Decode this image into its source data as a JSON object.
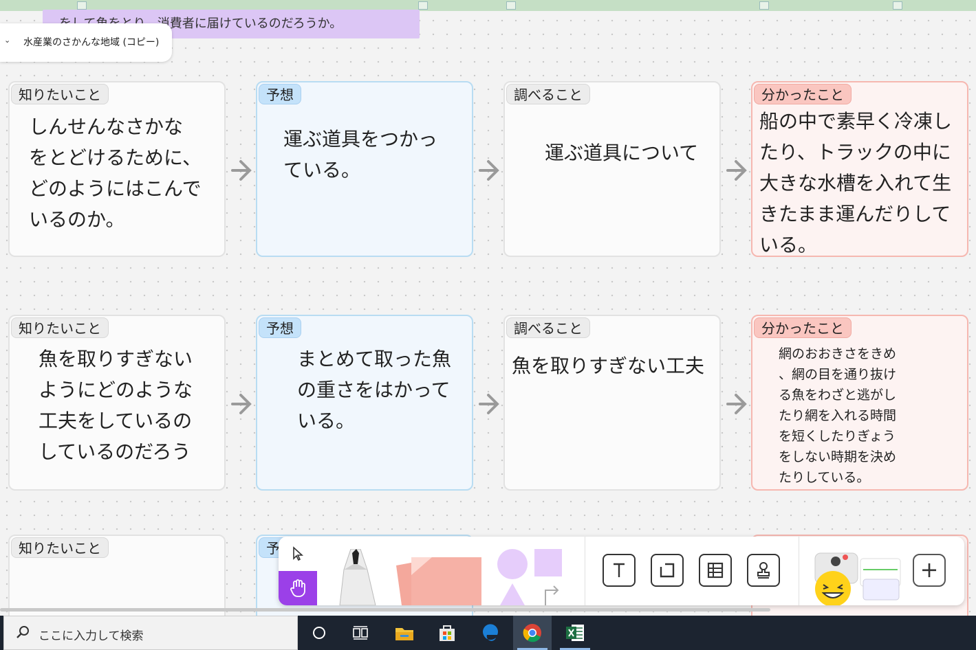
{
  "banner": {
    "text": "をして魚をとり、消費者に届けているのだろうか。"
  },
  "frame": {
    "chevron": "⌄",
    "title": "水産業のさかんな地域 (コピー)"
  },
  "rows": [
    {
      "want": {
        "tag": "知りたいこと",
        "text": "しんせんなさかな\nをとどけるために、\nどのようにはこんで\nいるのか。"
      },
      "predict": {
        "tag": "予想",
        "text": "運ぶ道具をつかっ\nている。"
      },
      "research": {
        "tag": "調べること",
        "text": "運ぶ道具について"
      },
      "learned": {
        "tag": "分かったこと",
        "text": "船の中で素早く冷凍し\nたり、トラックの中に\n大きな水槽を入れて生\nきたまま運んだりして\nいる。"
      }
    },
    {
      "want": {
        "tag": "知りたいこと",
        "text": "魚を取りすぎない\nようにどのような\n工夫をしているの\nしているのだろう"
      },
      "predict": {
        "tag": "予想",
        "text": "まとめて取った魚\nの重さをはかって\nいる。"
      },
      "research": {
        "tag": "調べること",
        "text": "魚を取りすぎない工夫"
      },
      "learned": {
        "tag": "分かったこと",
        "text": "網のおおきさをきめ\n、網の目を通り抜け\nる魚をわざと逃がし\nたり網を入れる時間\nを短くしたりぎょう\nをしない時期を決め\nたりしている。"
      }
    },
    {
      "want": {
        "tag": "知りたいこと",
        "text": ""
      },
      "predict": {
        "tag": "予",
        "text": ""
      }
    }
  ],
  "toolbar": {
    "tools": [
      "select-arrow-icon",
      "hand-icon",
      "pen-icon",
      "sticky-note-icon",
      "shapes-icon",
      "text-icon",
      "frame-icon",
      "table-icon",
      "stamp-icon",
      "jambot-icon"
    ],
    "add_label": "+",
    "active_tool": "hand-icon",
    "accent": "#9b40e8"
  },
  "taskbar": {
    "search_placeholder": "ここに入力して検索",
    "apps": [
      "cortana-icon",
      "task-view-icon",
      "file-explorer-icon",
      "microsoft-store-icon",
      "edge-icon",
      "chrome-icon",
      "excel-icon"
    ],
    "active_app": "chrome-icon"
  }
}
